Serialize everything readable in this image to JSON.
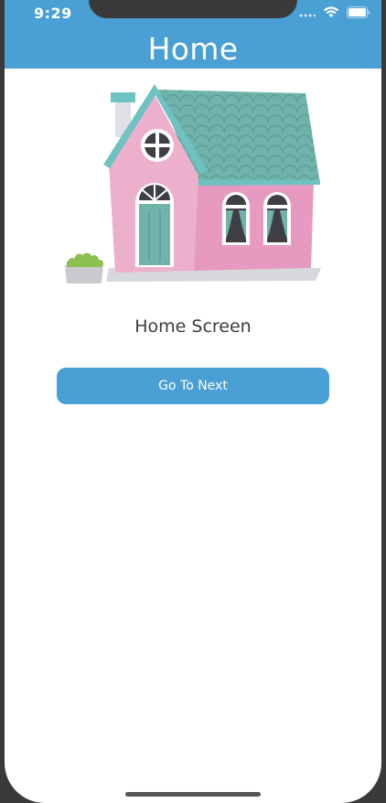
{
  "status_bar": {
    "time": "9:29",
    "icons": [
      "signal-dots-icon",
      "wifi-icon",
      "battery-icon"
    ]
  },
  "header": {
    "title": "Home"
  },
  "illustration": {
    "name": "house-illustration"
  },
  "main": {
    "subtitle": "Home Screen",
    "next_button_label": "Go To Next"
  },
  "colors": {
    "header_background": "#4a9fd5",
    "button_background": "#4a9fd5",
    "device_frame": "#3a3a3a"
  }
}
